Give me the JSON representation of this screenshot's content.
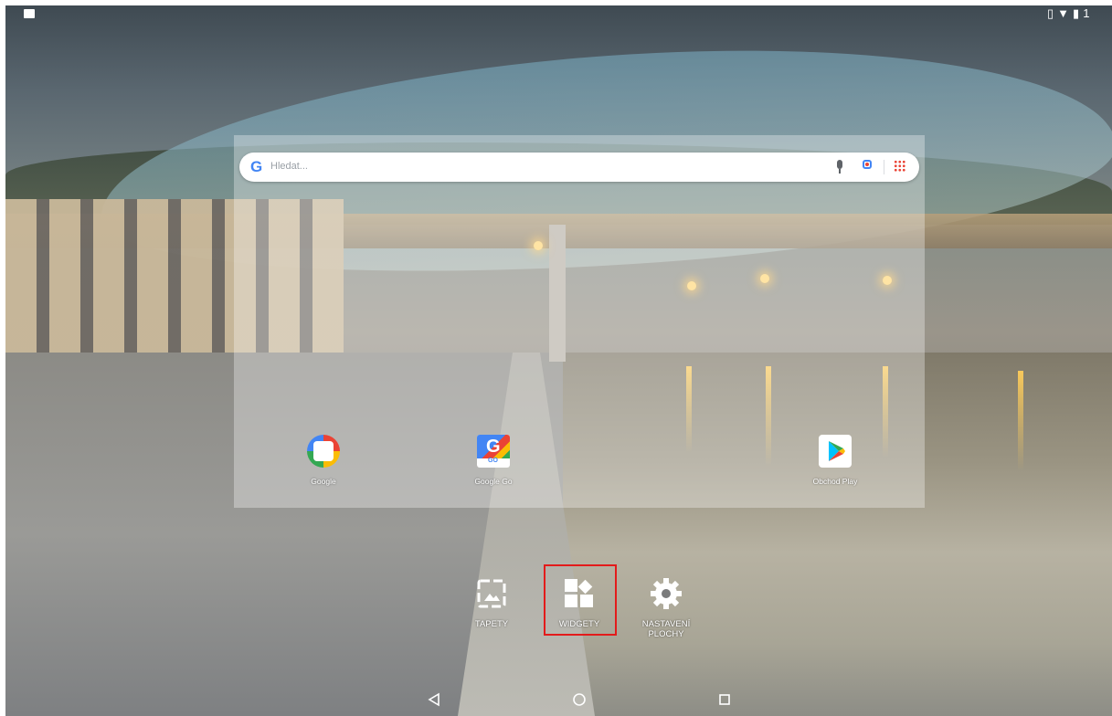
{
  "search": {
    "placeholder": "Hledat..."
  },
  "apps": [
    {
      "label": "Google"
    },
    {
      "label": "Google Go"
    },
    {
      "label": "Obchod Play"
    }
  ],
  "options": [
    {
      "label": "TAPETY"
    },
    {
      "label": "WIDGETY"
    },
    {
      "label": "NASTAVENÍ PLOCHY"
    }
  ],
  "status": {
    "right": "1"
  },
  "icons": {
    "status_left": "image-icon",
    "status_right": [
      "vibrate-icon",
      "wifi-icon",
      "battery-icon"
    ],
    "nav": [
      "back-icon",
      "home-icon",
      "recents-icon"
    ]
  },
  "colors": {
    "highlight": "#e31b1b",
    "google_blue": "#4285f4"
  }
}
